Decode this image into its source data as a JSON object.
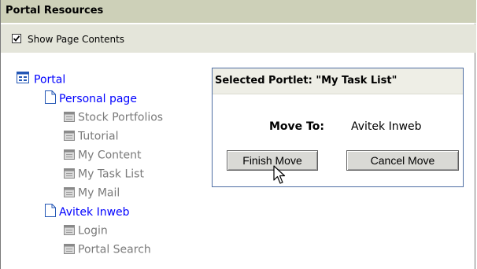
{
  "header": {
    "title": "Portal Resources"
  },
  "options": {
    "show_page_contents_label": "Show Page Contents",
    "show_page_contents_checked": true
  },
  "tree": {
    "root": "Portal",
    "pages": [
      {
        "label": "Personal page",
        "portlets": [
          "Stock Portfolios",
          "Tutorial",
          "My Content",
          "My Task List",
          "My Mail"
        ]
      },
      {
        "label": "Avitek Inweb",
        "portlets": [
          "Login",
          "Portal Search"
        ]
      }
    ]
  },
  "selected_portlet": {
    "title": "Selected Portlet: \"My Task List\"",
    "move_to_label": "Move To:",
    "move_to_value": "Avitek Inweb",
    "finish_button": "Finish Move",
    "cancel_button": "Cancel Move"
  },
  "colors": {
    "header_bg": "#cdd0b8",
    "subheader_bg": "#e4e5da",
    "link": "#0000ff",
    "dim_text": "#7a7a7a",
    "box_border": "#4f6ea3"
  },
  "icons": {
    "root": "portal-icon",
    "page": "page-icon",
    "portlet": "portlet-icon",
    "cursor": "mouse-pointer-icon"
  }
}
